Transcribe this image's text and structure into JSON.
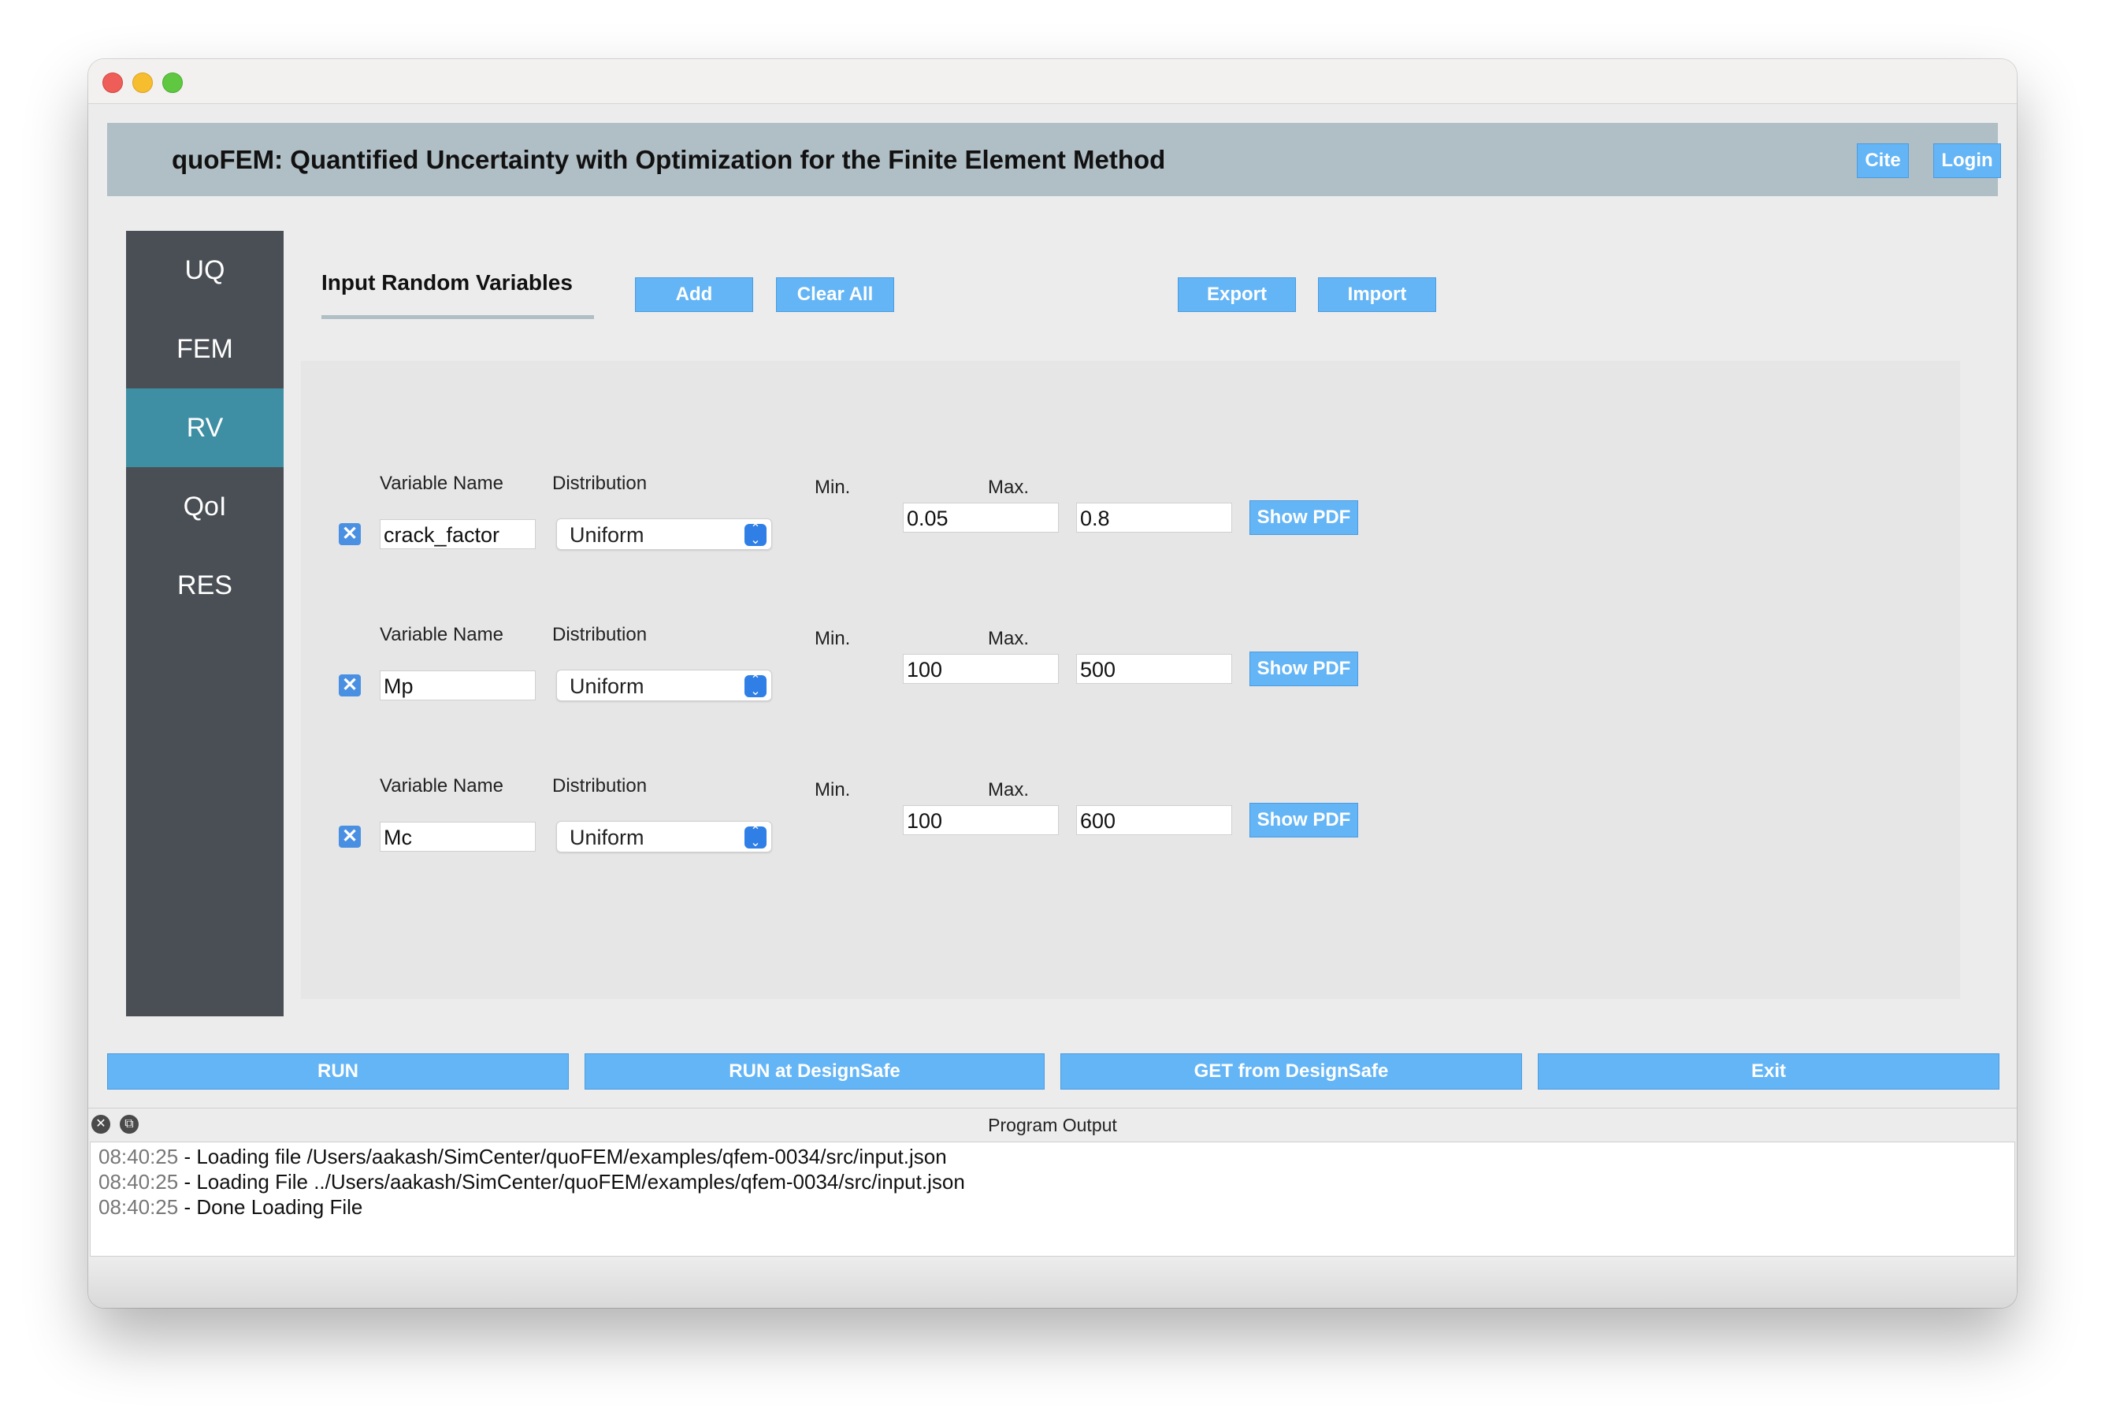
{
  "header": {
    "title": "quoFEM: Quantified Uncertainty with Optimization for the Finite Element Method",
    "cite_label": "Cite",
    "login_label": "Login"
  },
  "sidebar": {
    "items": [
      {
        "label": "UQ"
      },
      {
        "label": "FEM"
      },
      {
        "label": "RV",
        "active": true
      },
      {
        "label": "QoI"
      },
      {
        "label": "RES"
      }
    ]
  },
  "rv": {
    "title": "Input Random Variables",
    "add_label": "Add",
    "clear_label": "Clear All",
    "export_label": "Export",
    "import_label": "Import",
    "variable_name_label": "Variable Name",
    "distribution_label": "Distribution",
    "min_label": "Min.",
    "max_label": "Max.",
    "show_pdf_label": "Show PDF",
    "variables": [
      {
        "name": "crack_factor",
        "distribution": "Uniform",
        "min": "0.05",
        "max": "0.8"
      },
      {
        "name": "Mp",
        "distribution": "Uniform",
        "min": "100",
        "max": "500"
      },
      {
        "name": "Mc",
        "distribution": "Uniform",
        "min": "100",
        "max": "600"
      }
    ]
  },
  "bottom": {
    "run_label": "RUN",
    "run_ds_label": "RUN at DesignSafe",
    "get_ds_label": "GET from DesignSafe",
    "exit_label": "Exit"
  },
  "output": {
    "title": "Program Output",
    "lines": [
      {
        "time": "08:40:25",
        "text": " - Loading file /Users/aakash/SimCenter/quoFEM/examples/qfem-0034/src/input.json"
      },
      {
        "time": "08:40:25",
        "text": " - Loading File ../Users/aakash/SimCenter/quoFEM/examples/qfem-0034/src/input.json"
      },
      {
        "time": "08:40:25",
        "text": " - Done Loading File"
      }
    ]
  },
  "colors": {
    "button_blue": "#64b5f6",
    "header_gray": "#b0bec5",
    "sidebar_dark": "#4a4f55",
    "sidebar_active": "#3e8fa3"
  },
  "icons": {
    "remove": "close-x-icon",
    "select": "updown-chevron-icon",
    "close_output": "close-circle-icon",
    "float_output": "float-window-icon"
  }
}
